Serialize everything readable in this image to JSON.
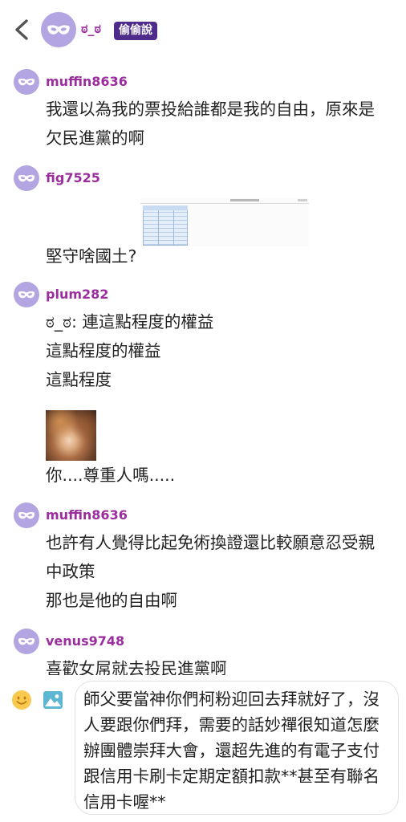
{
  "header": {
    "back_icon": "chevron-left-icon",
    "avatar_icon": "mask-icon",
    "name": "ಠ_ಠ",
    "badge": "偷偷說"
  },
  "colors": {
    "avatar": "#b3a4e2",
    "username": "#9b2d9e",
    "badge": "#4f2b8c",
    "text": "#222222"
  },
  "messages": [
    {
      "avatar_icon": "mask-icon",
      "username": "muffin8636",
      "lines": [
        "我還以為我的票投給誰都是我的自由，原來是",
        "欠民進黨的啊"
      ]
    },
    {
      "avatar_icon": "mask-icon",
      "username": "fig7525",
      "lines": [
        "堅守啥國土?"
      ]
    },
    {
      "avatar_icon": "mask-icon",
      "username": "plum282",
      "lines": [
        "ಠ_ಠ: 連這點程度的權益",
        "這點程度的權益",
        "這點程度"
      ],
      "lines_after_image": [
        "你....尊重人嗎....."
      ]
    },
    {
      "avatar_icon": "mask-icon",
      "username": "muffin8636",
      "lines": [
        "也許有人覺得比起免術換證還比較願意忍受親",
        "中政策",
        "那也是他的自由啊"
      ]
    },
    {
      "avatar_icon": "mask-icon",
      "username": "venus9748",
      "lines": [
        "喜歡女屌就去投民進黨啊"
      ]
    }
  ],
  "composer": {
    "emoji_icon": "smiley-icon",
    "image_icon": "image-icon",
    "input_lines": [
      "師父要當神你們柯粉迎回去拜就好了，沒",
      "人要跟你們拜，需要的話妙禪很知道怎麼",
      "辦團體崇拜大會，還超先進的有電子支付",
      "跟信用卡刷卡定期定額扣款**甚至有聯名",
      "信用卡喔**"
    ]
  }
}
